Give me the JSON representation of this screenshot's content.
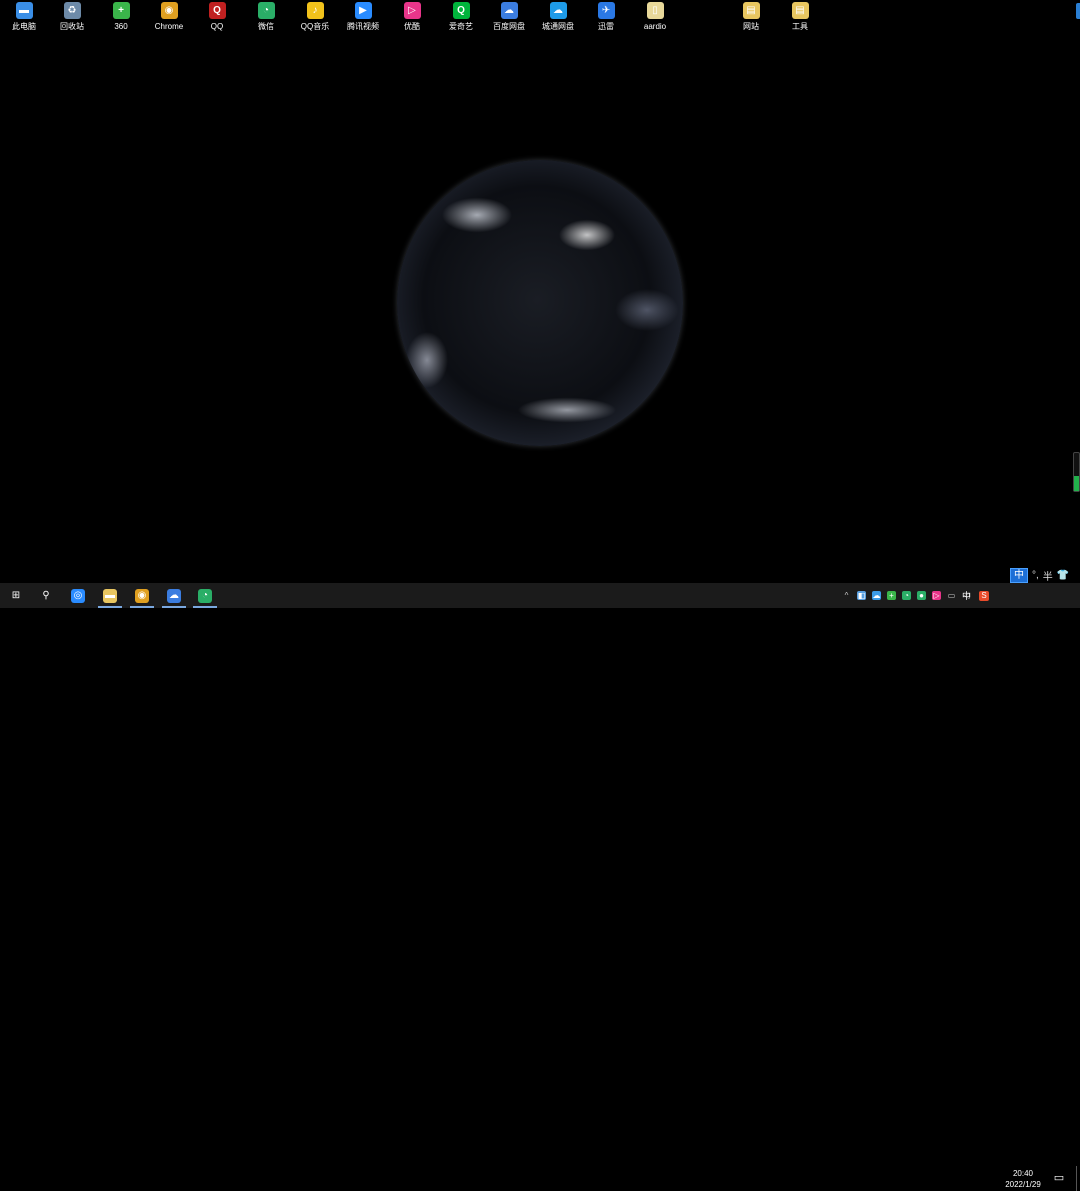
{
  "desktop_icons": [
    {
      "label": "此电脑",
      "icon": "computer-icon",
      "color": "#3a8ee6",
      "glyph": "▬"
    },
    {
      "label": "回收站",
      "icon": "recycle-bin-icon",
      "color": "#6d8aa8",
      "glyph": "♻"
    },
    {
      "label": "360",
      "icon": "360-icon",
      "color": "#3ab54a",
      "glyph": "+"
    },
    {
      "label": "Chrome",
      "icon": "chrome-icon",
      "color": "#e0a020",
      "glyph": "◉"
    },
    {
      "label": "QQ",
      "icon": "qq-icon",
      "color": "#c02020",
      "glyph": "Q"
    },
    {
      "label": "微信",
      "icon": "wechat-icon",
      "color": "#2aae67",
      "glyph": "◔"
    },
    {
      "label": "QQ音乐",
      "icon": "qq-music-icon",
      "color": "#f2c21b",
      "glyph": "♪"
    },
    {
      "label": "腾讯视频",
      "icon": "tencent-video-icon",
      "color": "#2a8cff",
      "glyph": "▶"
    },
    {
      "label": "优酷",
      "icon": "youku-icon",
      "color": "#e8358a",
      "glyph": "▷"
    },
    {
      "label": "爱奇艺",
      "icon": "iqiyi-icon",
      "color": "#00b43c",
      "glyph": "Q"
    },
    {
      "label": "百度网盘",
      "icon": "baidu-netdisk-icon",
      "color": "#3b7de0",
      "glyph": "☁"
    },
    {
      "label": "城通网盘",
      "icon": "ctfile-netdisk-icon",
      "color": "#1e9be8",
      "glyph": "☁"
    },
    {
      "label": "迅雷",
      "icon": "xunlei-icon",
      "color": "#2a78e4",
      "glyph": "✈"
    },
    {
      "label": "aardio",
      "icon": "aardio-file-icon",
      "color": "#e8d89a",
      "glyph": "▯"
    },
    {
      "label": "网站",
      "icon": "website-folder-icon",
      "color": "#e8c660",
      "glyph": "▤"
    },
    {
      "label": "工具",
      "icon": "tools-folder-icon",
      "color": "#e8c660",
      "glyph": "▤"
    }
  ],
  "ime_bar": {
    "lang": "中",
    "punct": "°,",
    "width": "半",
    "skin_icon": "shirt-icon"
  },
  "battery_level": 0.4,
  "taskbar": {
    "apps": [
      {
        "name": "start",
        "icon": "windows-start-icon",
        "color": "#ffffff",
        "glyph": "⊞"
      },
      {
        "name": "search",
        "icon": "search-icon",
        "color": "#ffffff",
        "glyph": "⚲"
      },
      {
        "name": "qq-browser",
        "icon": "browser-icon",
        "color": "#2a8cff",
        "glyph": "◎"
      },
      {
        "name": "file-explorer",
        "icon": "folder-icon",
        "color": "#e8c660",
        "glyph": "▬"
      },
      {
        "name": "chrome",
        "icon": "chrome-icon",
        "color": "#e0a020",
        "glyph": "◉"
      },
      {
        "name": "baidu-netdisk",
        "icon": "baidu-netdisk-icon",
        "color": "#3b7de0",
        "glyph": "☁"
      },
      {
        "name": "wechat",
        "icon": "wechat-icon",
        "color": "#2aae67",
        "glyph": "◔"
      }
    ],
    "tray": {
      "icons": [
        {
          "icon": "chevron-up-icon",
          "color": "#cccccc",
          "glyph": "^"
        },
        {
          "icon": "tray-app-icon",
          "color": "#5aa0e0",
          "glyph": "◧"
        },
        {
          "icon": "cloud-icon",
          "color": "#3b9ce8",
          "glyph": "☁"
        },
        {
          "icon": "360-icon",
          "color": "#3ab54a",
          "glyph": "+"
        },
        {
          "icon": "wechat-icon",
          "color": "#2aae67",
          "glyph": "◔"
        },
        {
          "icon": "green-app-icon",
          "color": "#2aae67",
          "glyph": "●"
        },
        {
          "icon": "youku-icon",
          "color": "#e8358a",
          "glyph": "▷"
        },
        {
          "icon": "display-icon",
          "color": "#cccccc",
          "glyph": "▭"
        },
        {
          "icon": "volume-muted-icon",
          "color": "#cccccc",
          "glyph": "◁"
        }
      ],
      "ime": "中",
      "ime_app_color": "#e84b2a"
    },
    "clock": {
      "time": "20:40",
      "date": "2022/1/29"
    }
  }
}
